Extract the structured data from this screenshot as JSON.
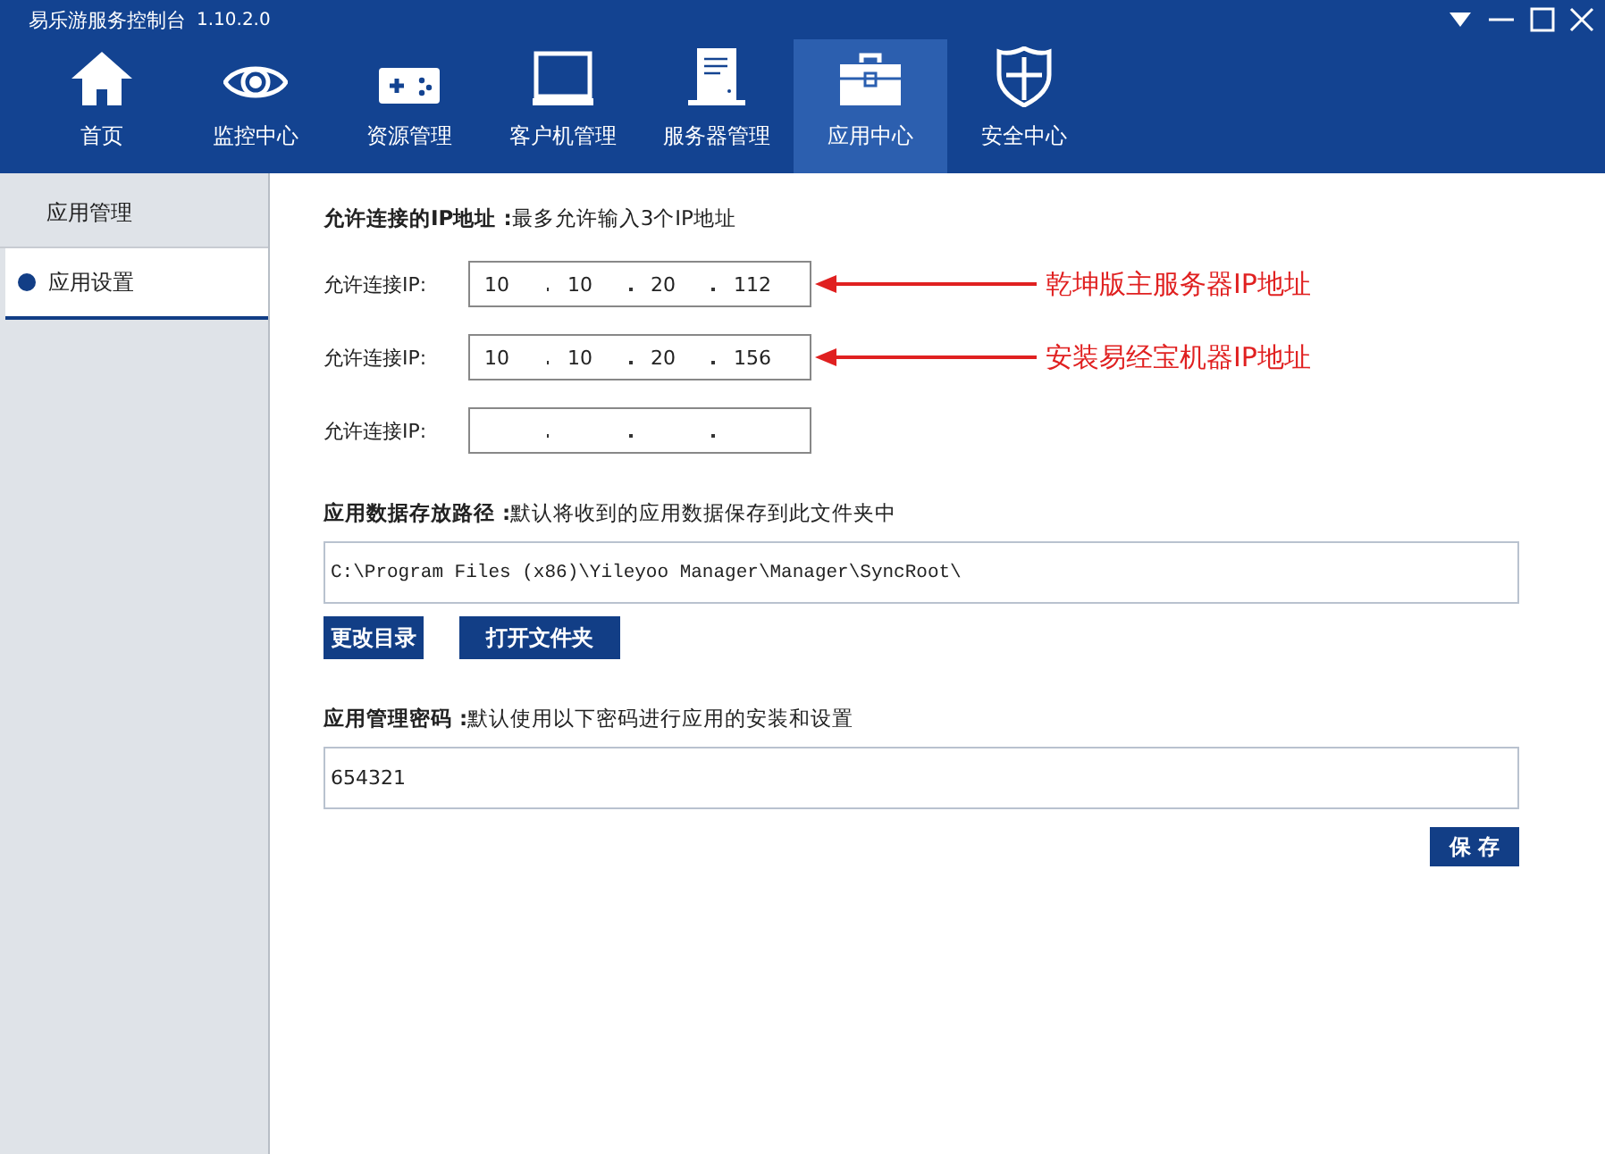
{
  "window": {
    "title": "易乐游服务控制台",
    "version": "1.10.2.0"
  },
  "nav": [
    {
      "label": "首页",
      "selected": false
    },
    {
      "label": "监控中心",
      "selected": false
    },
    {
      "label": "资源管理",
      "selected": false
    },
    {
      "label": "客户机管理",
      "selected": false
    },
    {
      "label": "服务器管理",
      "selected": false
    },
    {
      "label": "应用中心",
      "selected": true
    },
    {
      "label": "安全中心",
      "selected": false
    }
  ],
  "sidebar": {
    "items": [
      {
        "label": "应用管理",
        "selected": false
      },
      {
        "label": "应用设置",
        "selected": true
      }
    ]
  },
  "ip_section": {
    "heading": "允许连接的IP地址 :",
    "note": "最多允许输入3个IP地址",
    "rows": [
      {
        "label": "允许连接IP:",
        "octets": [
          "10",
          "10",
          "20",
          "112"
        ],
        "annotation": "乾坤版主服务器IP地址"
      },
      {
        "label": "允许连接IP:",
        "octets": [
          "10",
          "10",
          "20",
          "156"
        ],
        "annotation": "安装易经宝机器IP地址"
      },
      {
        "label": "允许连接IP:"
      }
    ]
  },
  "path_section": {
    "heading": "应用数据存放路径 :",
    "note": "默认将收到的应用数据保存到此文件夹中",
    "value": "C:\\Program Files (x86)\\Yileyoo Manager\\Manager\\SyncRoot\\",
    "buttons": [
      "更改目录",
      "打开文件夹"
    ]
  },
  "password_section": {
    "heading": "应用管理密码 :",
    "note": "默认使用以下密码进行应用的安装和设置",
    "value": "654321"
  },
  "save_button": "保 存"
}
